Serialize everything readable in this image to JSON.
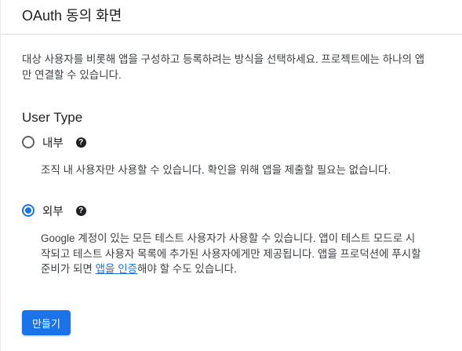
{
  "header": {
    "title": "OAuth 동의 화면"
  },
  "intro": "대상 사용자를 비롯해 앱을 구성하고 등록하려는 방식을 선택하세요. 프로젝트에는 하나의 앱만 연결할 수 있습니다.",
  "user_type": {
    "title": "User Type",
    "options": [
      {
        "label": "내부",
        "selected": false,
        "help_icon": "help-circle-icon",
        "description": "조직 내 사용자만 사용할 수 있습니다. 확인을 위해 앱을 제출할 필요는 없습니다."
      },
      {
        "label": "외부",
        "selected": true,
        "help_icon": "help-circle-icon",
        "description_before": "Google 계정이 있는 모든 테스트 사용자가 사용할 수 있습니다. 앱이 테스트 모드로 시작되고 테스트 사용자 목록에 추가된 사용자에게만 제공됩니다. 앱을 프로덕션에 푸시할 준비가 되면 ",
        "description_link": "앱을 인증",
        "description_after": "해야 할 수도 있습니다."
      }
    ]
  },
  "actions": {
    "create_label": "만들기"
  },
  "colors": {
    "accent": "#1a73e8",
    "text": "#202124",
    "secondary_text": "#3c4043"
  }
}
